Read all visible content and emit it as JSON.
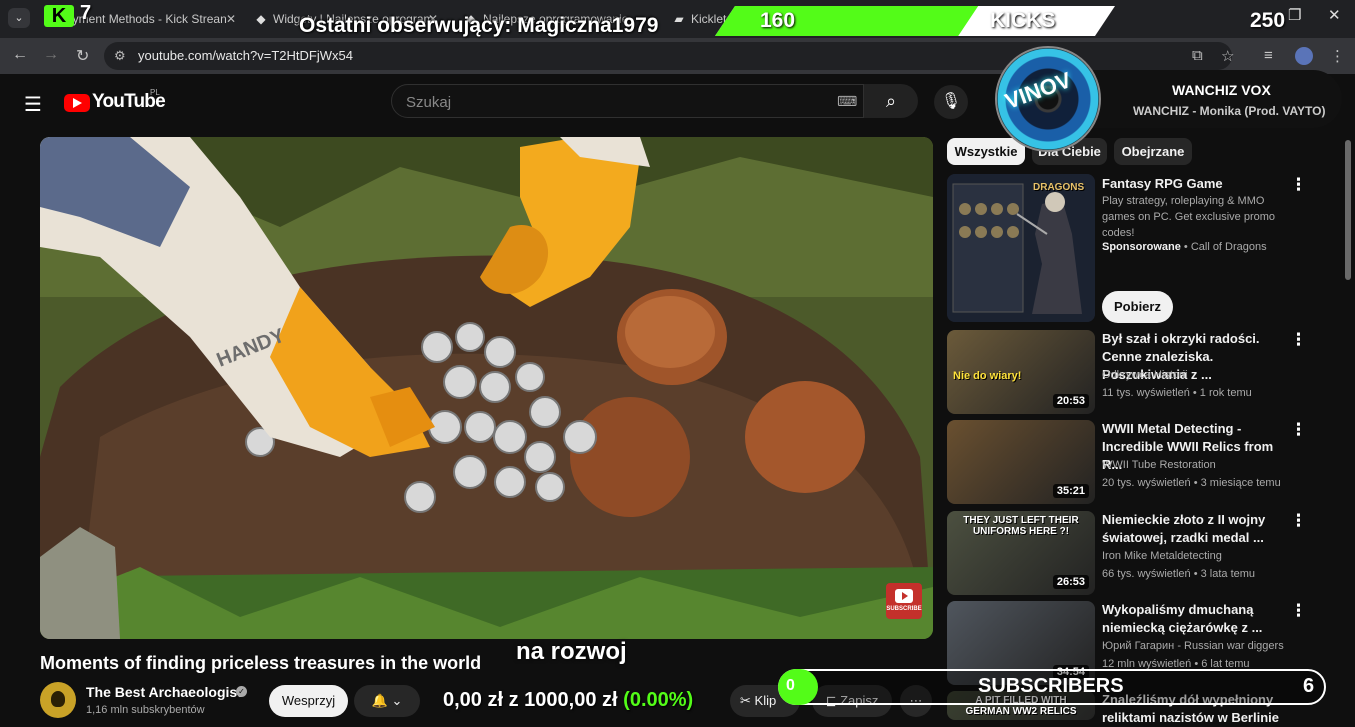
{
  "browser": {
    "tabs": [
      {
        "label": "Payment Methods - Kick Strean"
      },
      {
        "label": "Widgety | Najlepsze oprogram"
      },
      {
        "label": "Najlepsze oprogramowanie"
      },
      {
        "label": "Kicklet.a"
      }
    ],
    "url": "youtube.com/watch?v=T2HtDFjWx54"
  },
  "youtube": {
    "logo_text": "YouTube",
    "country": "PL",
    "search_placeholder": "Szukaj"
  },
  "video": {
    "title": "Moments of finding priceless treasures in the world",
    "caption": "na rozwoj",
    "subscribe_overlay": "SUBSCRIBE",
    "channel_name": "The Best Archaeologist",
    "channel_subs": "1,16 mln subskrybentów",
    "support_label": "Wesprzyj",
    "clip_label": "Klip",
    "save_label": "Zapisz"
  },
  "chips": [
    "Wszystkie",
    "Dla Ciebie",
    "Obejrzane"
  ],
  "ad": {
    "title": "Fantasy RPG Game",
    "desc": "Play strategy, roleplaying & MMO games on PC. Get exclusive promo codes!",
    "sponsored": "Sponsorowane",
    "advertiser": "Call of Dragons",
    "cta": "Pobierz",
    "thumb_text": "DRAGONS"
  },
  "recommendations": [
    {
      "title": "Był szał i okrzyki radości. Cenne znaleziska.  Poszukiwania z ...",
      "channel": "Odkrywca Historii",
      "meta": "11 tys. wyświetleń • 1 rok temu",
      "duration": "20:53",
      "thumb_text": "Nie do wiary!"
    },
    {
      "title": "WWII Metal Detecting - Incredible WWII Relics from R...",
      "channel": "WWII Tube Restoration",
      "meta": "20 tys. wyświetleń • 3 miesiące temu",
      "duration": "35:21",
      "thumb_text": ""
    },
    {
      "title": "Niemieckie złoto z II wojny światowej, rzadki medal ...",
      "channel": "Iron Mike Metaldetecting",
      "meta": "66 tys. wyświetleń • 3 lata temu",
      "duration": "26:53",
      "thumb_text": "THEY JUST LEFT THEIR UNIFORMS HERE ?!"
    },
    {
      "title": "Wykopaliśmy dmuchaną niemiecką ciężarówkę z ...",
      "channel": "Юрий Гагарин - Russian war diggers",
      "meta": "12 mln wyświetleń • 6 lat temu",
      "duration": "34:54",
      "thumb_text": ""
    },
    {
      "title": "Znaleźliśmy dół wypełniony reliktami nazistów w Berlinie",
      "channel": "",
      "meta": "",
      "duration": "",
      "thumb_text": "A PIT FILLED WITH GERMAN WW2 RELICS"
    }
  ],
  "overlay": {
    "kick_logo": "K",
    "kick_count": "7",
    "last_follower": "Ostatni obserwujący: Magiczna1979",
    "kicks": {
      "current": "160",
      "label": "KICKS",
      "goal": "250",
      "progress": 0.64
    },
    "music": {
      "artist": "WANCHIZ VOX",
      "track": "WANCHIZ - Monika (Prod. VAYTO)",
      "disc_label": "VINOV"
    },
    "donation": {
      "current": "0,00 zł",
      "sep": "z",
      "goal": "1000,00 zł",
      "percent": "(0.00%)"
    },
    "subscribers": {
      "current": "0",
      "label": "SUBSCRIBERS",
      "goal": "6"
    }
  },
  "colors": {
    "kick_green": "#53fc18",
    "yt_red": "#ff0000",
    "background": "#0f0f0f"
  }
}
